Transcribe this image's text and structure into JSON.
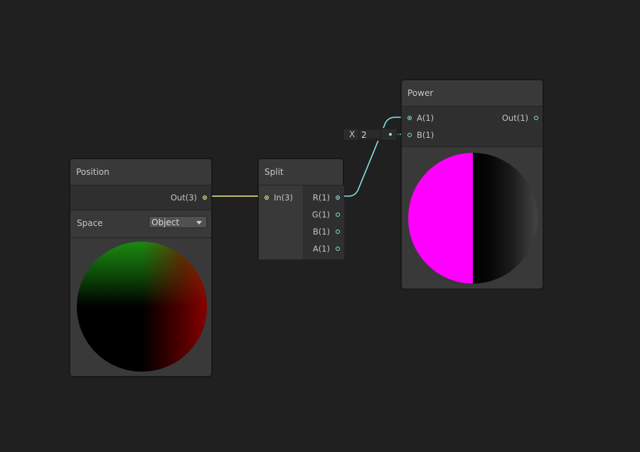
{
  "nodes": {
    "position": {
      "title": "Position",
      "output": "Out(3)",
      "space_label": "Space",
      "space_value": "Object"
    },
    "split": {
      "title": "Split",
      "input": "In(3)",
      "outputs": [
        "R(1)",
        "G(1)",
        "B(1)",
        "A(1)"
      ]
    },
    "power": {
      "title": "Power",
      "inputs": [
        "A(1)",
        "B(1)"
      ],
      "output": "Out(1)"
    }
  },
  "inline_value": {
    "label": "X",
    "value": "2"
  },
  "colors": {
    "background": "#202020",
    "node": "#393939",
    "vector3_wire": "#f0f08a",
    "vector1_wire": "#84e4e7"
  }
}
